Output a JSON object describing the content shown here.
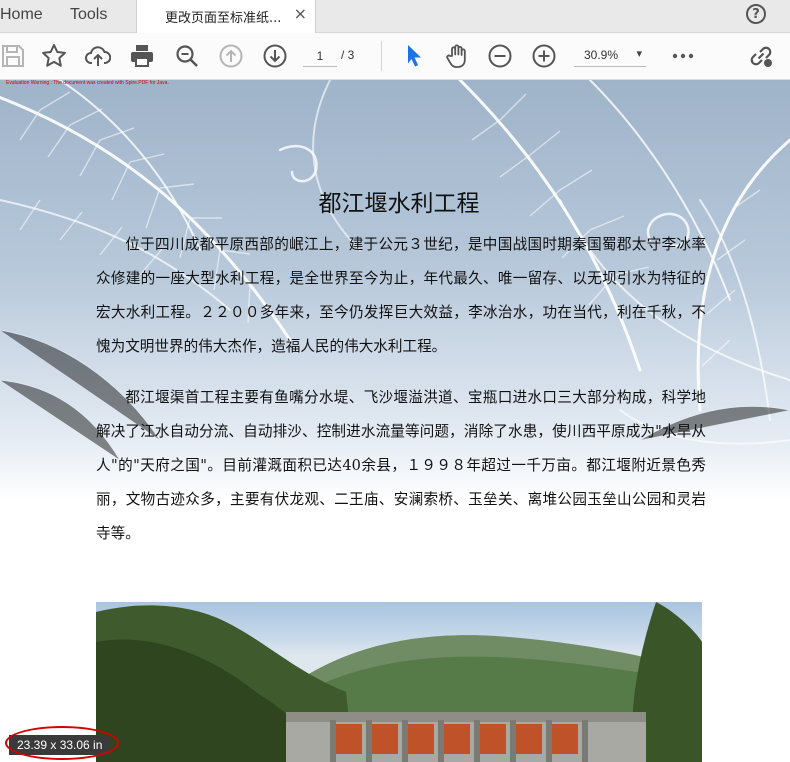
{
  "menu": {
    "home_label": "Home",
    "tools_label": "Tools",
    "help_glyph": "?"
  },
  "tab": {
    "title": "更改页面至标准纸...",
    "close_glyph": "×"
  },
  "toolbar": {
    "icons": [
      "save-icon",
      "bookmark-star-icon",
      "cloud-upload-icon",
      "print-icon",
      "zoom-search-icon",
      "prev-page-icon",
      "next-page-icon",
      "select-cursor-icon",
      "hand-pan-icon",
      "zoom-out-icon",
      "zoom-in-icon",
      "more-icon",
      "share-link-icon"
    ],
    "current_page": "1",
    "page_total": "/ 3",
    "zoom": "30.9%",
    "zoom_caret": "▾",
    "accent_color": "#1a73e8"
  },
  "document": {
    "eval_warning": "Evaluation Warning : The document was created with Spire.PDF for Java.",
    "title": "都江堰水利工程",
    "paragraphs": [
      "位于四川成都平原西部的岷江上，建于公元３世纪，是中国战国时期秦国蜀郡太守李冰率众修建的一座大型水利工程，是全世界至今为止，年代最久、唯一留存、以无坝引水为特征的宏大水利工程。２２００多年来，至今仍发挥巨大效益，李冰治水，功在当代，利在千秋，不愧为文明世界的伟大杰作，造福人民的伟大水利工程。",
      "都江堰渠首工程主要有鱼嘴分水堤、飞沙堰溢洪道、宝瓶口进水口三大部分构成，科学地解决了江水自动分流、自动排沙、控制进水流量等问题，消除了水患，使川西平原成为\"水旱从人\"的\"天府之国\"。目前灌溉面积已达40余县，１９９８年超过一千万亩。都江堰附近景色秀丽，文物古迹众多，主要有伏龙观、二王庙、安澜索桥、玉垒关、离堆公园玉垒山公园和灵岩寺等。"
    ]
  },
  "status": {
    "page_size": "23.39 x 33.06 in",
    "highlight_color": "#d60000"
  }
}
